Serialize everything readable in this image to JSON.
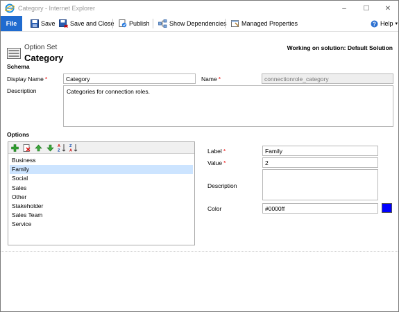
{
  "window": {
    "title": "Category - Internet Explorer",
    "controls": {
      "minimize": "–",
      "maximize": "☐",
      "close": "✕"
    }
  },
  "ribbon": {
    "file_label": "File",
    "save_label": "Save",
    "save_close_label": "Save and Close",
    "publish_label": "Publish",
    "dependencies_label": "Show Dependencies",
    "managed_label": "Managed Properties",
    "help_label": "Help"
  },
  "header": {
    "entity_type": "Option Set",
    "entity_name": "Category",
    "working_on": "Working on solution: Default Solution"
  },
  "schema": {
    "section_title": "Schema",
    "display_name_label": "Display Name",
    "display_name_value": "Category",
    "name_label": "Name",
    "name_value": "connectionrole_category",
    "description_label": "Description",
    "description_value": "Categories for connection roles."
  },
  "options": {
    "section_title": "Options",
    "items": [
      {
        "label": "Business",
        "selected": false
      },
      {
        "label": "Family",
        "selected": true
      },
      {
        "label": "Social",
        "selected": false
      },
      {
        "label": "Sales",
        "selected": false
      },
      {
        "label": "Other",
        "selected": false
      },
      {
        "label": "Stakeholder",
        "selected": false
      },
      {
        "label": "Sales Team",
        "selected": false
      },
      {
        "label": "Service",
        "selected": false
      }
    ],
    "toolbar_icons": [
      "add-icon",
      "delete-icon",
      "move-up-icon",
      "move-down-icon",
      "sort-ascending-icon",
      "sort-descending-icon"
    ]
  },
  "detail": {
    "label_label": "Label",
    "label_value": "Family",
    "value_label": "Value",
    "value_value": "2",
    "description_label": "Description",
    "description_value": "",
    "color_label": "Color",
    "color_value": "#0000ff"
  },
  "colors": {
    "accent": "#1f6bcf",
    "selected_row": "#cce4ff",
    "required": "#e00000",
    "option_color": "#0000ff"
  }
}
